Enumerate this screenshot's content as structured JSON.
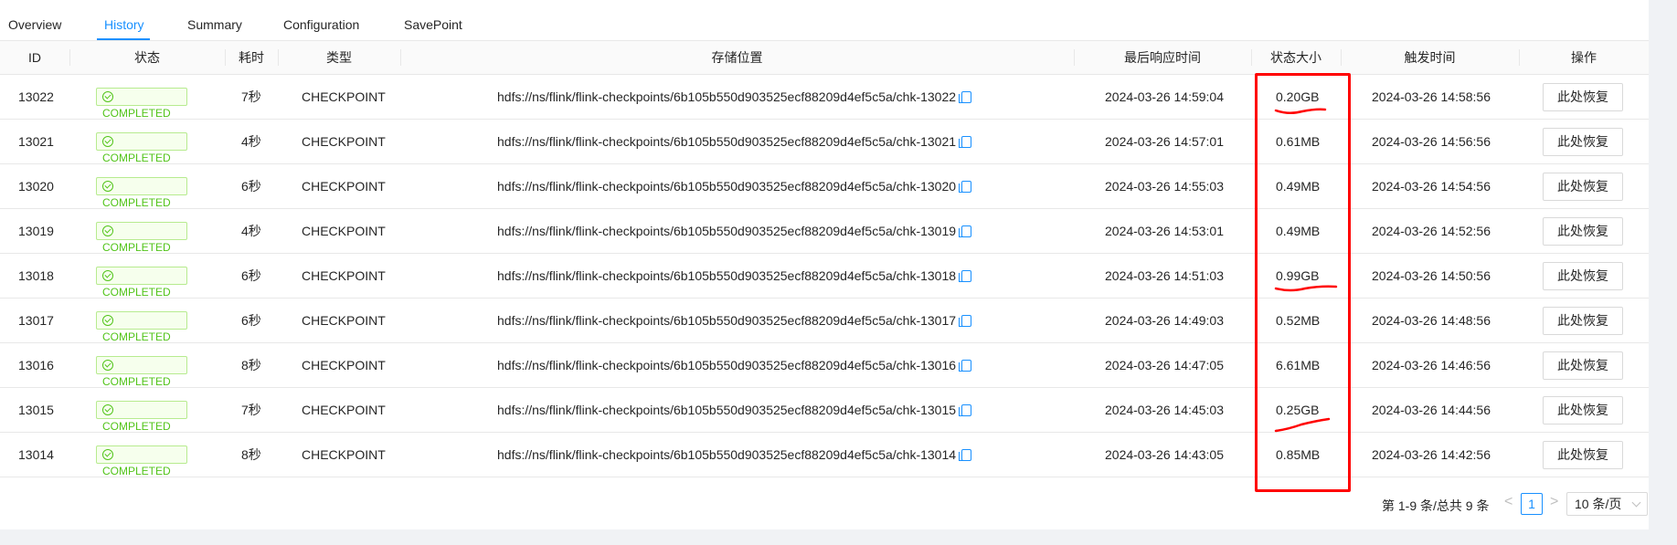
{
  "tabs": [
    {
      "label": "Overview"
    },
    {
      "label": "History"
    },
    {
      "label": "Summary"
    },
    {
      "label": "Configuration"
    },
    {
      "label": "SavePoint"
    }
  ],
  "columns": {
    "id": "ID",
    "status": "状态",
    "duration": "耗时",
    "type": "类型",
    "location": "存储位置",
    "last_response": "最后响应时间",
    "state_size": "状态大小",
    "trigger_time": "触发时间",
    "action": "操作"
  },
  "rows": [
    {
      "id": "13022",
      "status": "COMPLETED",
      "duration": "7秒",
      "type": "CHECKPOINT",
      "location": "hdfs://ns/flink/flink-checkpoints/6b105b550d903525ecf88209d4ef5c5a/chk-13022",
      "last_response": "2024-03-26 14:59:04",
      "state_size": "0.20GB",
      "trigger_time": "2024-03-26 14:58:56",
      "action": "此处恢复"
    },
    {
      "id": "13021",
      "status": "COMPLETED",
      "duration": "4秒",
      "type": "CHECKPOINT",
      "location": "hdfs://ns/flink/flink-checkpoints/6b105b550d903525ecf88209d4ef5c5a/chk-13021",
      "last_response": "2024-03-26 14:57:01",
      "state_size": "0.61MB",
      "trigger_time": "2024-03-26 14:56:56",
      "action": "此处恢复"
    },
    {
      "id": "13020",
      "status": "COMPLETED",
      "duration": "6秒",
      "type": "CHECKPOINT",
      "location": "hdfs://ns/flink/flink-checkpoints/6b105b550d903525ecf88209d4ef5c5a/chk-13020",
      "last_response": "2024-03-26 14:55:03",
      "state_size": "0.49MB",
      "trigger_time": "2024-03-26 14:54:56",
      "action": "此处恢复"
    },
    {
      "id": "13019",
      "status": "COMPLETED",
      "duration": "4秒",
      "type": "CHECKPOINT",
      "location": "hdfs://ns/flink/flink-checkpoints/6b105b550d903525ecf88209d4ef5c5a/chk-13019",
      "last_response": "2024-03-26 14:53:01",
      "state_size": "0.49MB",
      "trigger_time": "2024-03-26 14:52:56",
      "action": "此处恢复"
    },
    {
      "id": "13018",
      "status": "COMPLETED",
      "duration": "6秒",
      "type": "CHECKPOINT",
      "location": "hdfs://ns/flink/flink-checkpoints/6b105b550d903525ecf88209d4ef5c5a/chk-13018",
      "last_response": "2024-03-26 14:51:03",
      "state_size": "0.99GB",
      "trigger_time": "2024-03-26 14:50:56",
      "action": "此处恢复"
    },
    {
      "id": "13017",
      "status": "COMPLETED",
      "duration": "6秒",
      "type": "CHECKPOINT",
      "location": "hdfs://ns/flink/flink-checkpoints/6b105b550d903525ecf88209d4ef5c5a/chk-13017",
      "last_response": "2024-03-26 14:49:03",
      "state_size": "0.52MB",
      "trigger_time": "2024-03-26 14:48:56",
      "action": "此处恢复"
    },
    {
      "id": "13016",
      "status": "COMPLETED",
      "duration": "8秒",
      "type": "CHECKPOINT",
      "location": "hdfs://ns/flink/flink-checkpoints/6b105b550d903525ecf88209d4ef5c5a/chk-13016",
      "last_response": "2024-03-26 14:47:05",
      "state_size": "6.61MB",
      "trigger_time": "2024-03-26 14:46:56",
      "action": "此处恢复"
    },
    {
      "id": "13015",
      "status": "COMPLETED",
      "duration": "7秒",
      "type": "CHECKPOINT",
      "location": "hdfs://ns/flink/flink-checkpoints/6b105b550d903525ecf88209d4ef5c5a/chk-13015",
      "last_response": "2024-03-26 14:45:03",
      "state_size": "0.25GB",
      "trigger_time": "2024-03-26 14:44:56",
      "action": "此处恢复"
    },
    {
      "id": "13014",
      "status": "COMPLETED",
      "duration": "8秒",
      "type": "CHECKPOINT",
      "location": "hdfs://ns/flink/flink-checkpoints/6b105b550d903525ecf88209d4ef5c5a/chk-13014",
      "last_response": "2024-03-26 14:43:05",
      "state_size": "0.85MB",
      "trigger_time": "2024-03-26 14:42:56",
      "action": "此处恢复"
    }
  ],
  "pagination": {
    "total": "第 1-9 条/总共 9 条",
    "prev": "<",
    "current": "1",
    "next": ">",
    "page_size": "10 条/页"
  },
  "colors": {
    "accent": "#1890ff",
    "success": "#52c41a",
    "annotation": "#ff0000"
  }
}
